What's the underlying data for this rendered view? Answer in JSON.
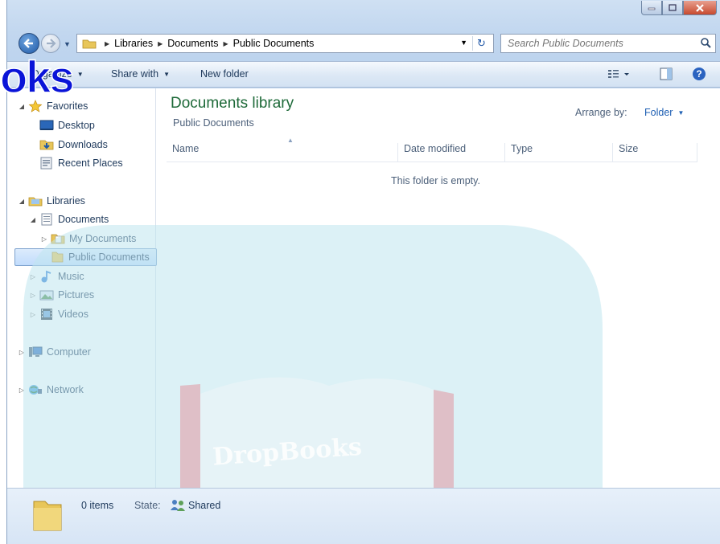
{
  "window": {
    "caption_buttons": [
      "minimize-icon",
      "maximize-icon",
      "close-icon"
    ]
  },
  "address": {
    "breadcrumbs": [
      "Libraries",
      "Documents",
      "Public Documents"
    ],
    "search_placeholder": "Search Public Documents"
  },
  "toolbar": {
    "organize_label": "Organize",
    "share_label": "Share with",
    "new_folder_label": "New folder"
  },
  "watermark": {
    "text": "oks",
    "logo_text": "DropBooks"
  },
  "sidebar": {
    "favorites": {
      "label": "Favorites",
      "items": [
        "Desktop",
        "Downloads",
        "Recent Places"
      ]
    },
    "libraries": {
      "label": "Libraries",
      "documents": {
        "label": "Documents",
        "children": [
          "My Documents",
          "Public Documents"
        ]
      },
      "others": [
        "Music",
        "Pictures",
        "Videos"
      ]
    },
    "computer": "Computer",
    "network": "Network",
    "selected": "Public Documents"
  },
  "main": {
    "title": "Documents library",
    "subtitle": "Public Documents",
    "arrange_label": "Arrange by:",
    "arrange_value": "Folder",
    "columns": [
      "Name",
      "Date modified",
      "Type",
      "Size"
    ],
    "empty_message": "This folder is empty."
  },
  "details": {
    "items": "0 items",
    "state_label": "State:",
    "state_value": "Shared"
  },
  "colors": {
    "title_green": "#1e6a39",
    "link_blue": "#1e5fb3",
    "watermark_teal": "#bfe6ee",
    "watermark_text_blue": "#0a14d8"
  }
}
